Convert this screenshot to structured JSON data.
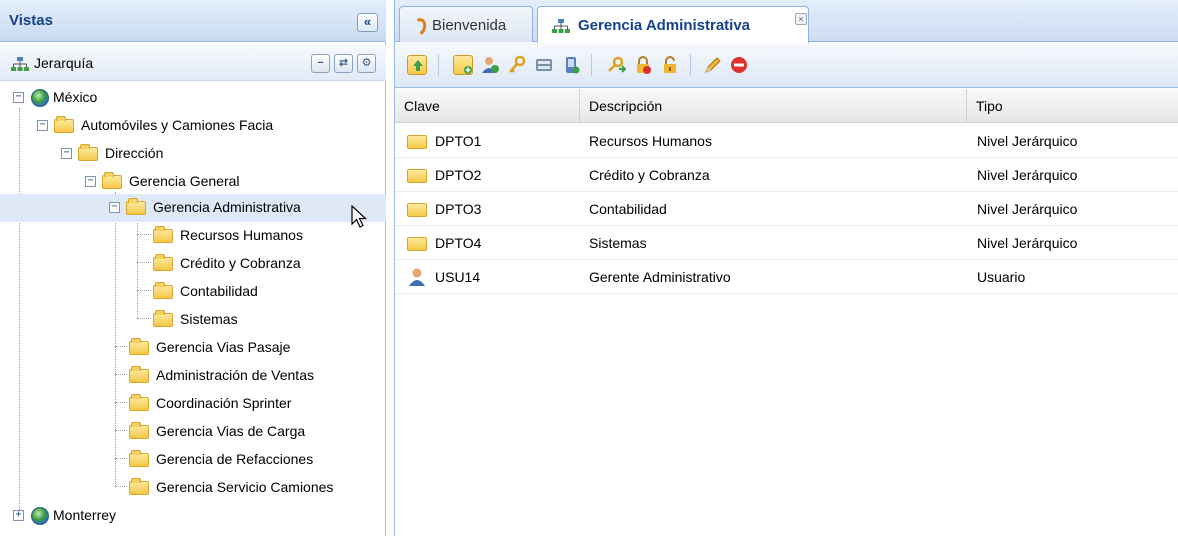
{
  "left_panel": {
    "title": "Vistas",
    "collapse_glyph": "«",
    "toolbar_label": "Jerarquía",
    "tool_minus": "−",
    "tool_refresh": "⇄",
    "tool_settings": "⚙"
  },
  "tree": [
    {
      "label": "México",
      "icon": "globe-icon",
      "expander": "−"
    },
    {
      "label": "Automóviles y Camiones Facia",
      "icon": "folder-icon",
      "expander": "−"
    },
    {
      "label": "Dirección",
      "icon": "folder-icon",
      "expander": "−"
    },
    {
      "label": "Gerencia General",
      "icon": "folder-icon",
      "expander": "−"
    },
    {
      "label": "Gerencia Administrativa",
      "icon": "folder-icon",
      "expander": "−",
      "selected": true
    },
    {
      "label": "Recursos Humanos",
      "icon": "folder-icon"
    },
    {
      "label": "Crédito y Cobranza",
      "icon": "folder-icon"
    },
    {
      "label": "Contabilidad",
      "icon": "folder-icon"
    },
    {
      "label": "Sistemas",
      "icon": "folder-icon"
    },
    {
      "label": "Gerencia Vias Pasaje",
      "icon": "folder-icon"
    },
    {
      "label": "Administración de Ventas",
      "icon": "folder-icon"
    },
    {
      "label": "Coordinación Sprinter",
      "icon": "folder-icon"
    },
    {
      "label": "Gerencia Vias de Carga",
      "icon": "folder-icon"
    },
    {
      "label": "Gerencia de Refacciones",
      "icon": "folder-icon"
    },
    {
      "label": "Gerencia Servicio Camiones",
      "icon": "folder-icon"
    },
    {
      "label": "Monterrey",
      "icon": "globe-icon",
      "expander": "+"
    }
  ],
  "tabs": {
    "welcome": "Bienvenida",
    "active": "Gerencia Administrativa",
    "close_glyph": "×"
  },
  "grid": {
    "headers": {
      "clave": "Clave",
      "descripcion": "Descripción",
      "tipo": "Tipo"
    },
    "rows": [
      {
        "clave": "DPTO1",
        "descripcion": "Recursos Humanos",
        "tipo": "Nivel Jerárquico",
        "icon": "folder-icon"
      },
      {
        "clave": "DPTO2",
        "descripcion": "Crédito y Cobranza",
        "tipo": "Nivel Jerárquico",
        "icon": "folder-icon"
      },
      {
        "clave": "DPTO3",
        "descripcion": "Contabilidad",
        "tipo": "Nivel Jerárquico",
        "icon": "folder-icon"
      },
      {
        "clave": "DPTO4",
        "descripcion": "Sistemas",
        "tipo": "Nivel Jerárquico",
        "icon": "folder-icon"
      },
      {
        "clave": "USU14",
        "descripcion": "Gerente Administrativo",
        "tipo": "Usuario",
        "icon": "user-icon"
      }
    ]
  },
  "colors": {
    "header_text": "#15428b",
    "border": "#99bbe8",
    "selection": "#dfe8f6",
    "folder": "#f4c948"
  }
}
